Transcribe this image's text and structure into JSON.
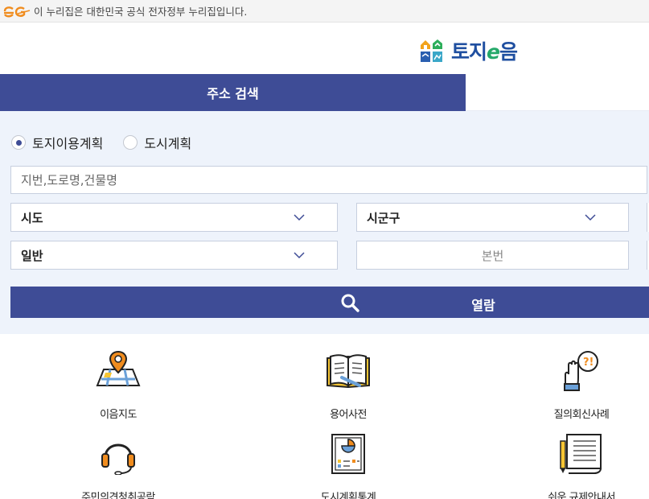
{
  "gov_banner": {
    "text": "이 누리집은 대한민국 공식 전자정부 누리집입니다.",
    "logo_icon": "egov-logo-icon"
  },
  "brand": {
    "name_prefix": "토지",
    "name_e": "e",
    "name_suffix": "음",
    "icon": "house-grid-logo-icon"
  },
  "tabs": [
    {
      "label": "주소 검색",
      "active": true
    },
    {
      "label": "",
      "active": false
    }
  ],
  "search": {
    "radios": [
      {
        "label": "토지이용계획",
        "checked": true
      },
      {
        "label": "도시계획",
        "checked": false
      }
    ],
    "address_placeholder": "지번,도로명,건물명",
    "address_value": "",
    "sido": {
      "selected": "시도"
    },
    "sigungu": {
      "selected": "시군구"
    },
    "gubun": {
      "selected": "일반"
    },
    "bonbun_placeholder": "본번",
    "view_button": "열람",
    "view_button_icon": "search-icon"
  },
  "quick_menu": [
    {
      "label": "이음지도",
      "icon": "map-pin-icon"
    },
    {
      "label": "용어사전",
      "icon": "open-book-icon"
    },
    {
      "label": "질의회신사례",
      "icon": "question-hand-icon"
    },
    {
      "label": "주민의견청취공람",
      "icon": "headset-icon"
    },
    {
      "label": "도시계획통계",
      "icon": "chart-board-icon"
    },
    {
      "label": "쉬운 규제안내서",
      "icon": "scroll-document-icon"
    }
  ],
  "colors": {
    "primary": "#3e4c96",
    "panel_bg": "#eef3fb",
    "brand_blue": "#1f4fa0",
    "brand_green": "#25a96a",
    "icon_orange": "#f08c1e",
    "icon_yellow": "#f6c533"
  }
}
